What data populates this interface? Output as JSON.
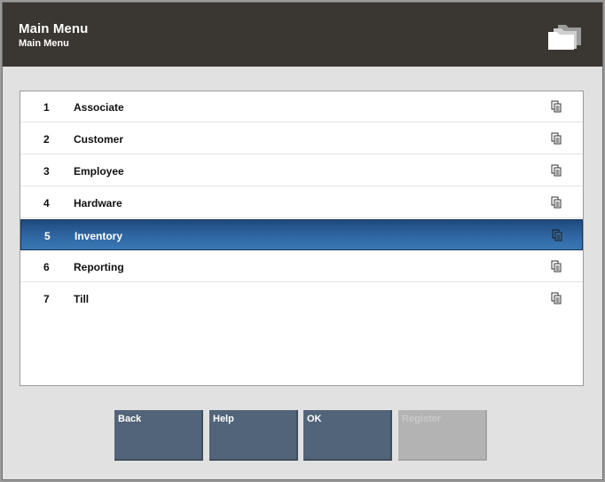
{
  "header": {
    "title": "Main Menu",
    "subtitle": "Main Menu",
    "icon": "folders-icon"
  },
  "menu": {
    "selected_index": 4,
    "items": [
      {
        "number": "1",
        "label": "Associate"
      },
      {
        "number": "2",
        "label": "Customer"
      },
      {
        "number": "3",
        "label": "Employee"
      },
      {
        "number": "4",
        "label": "Hardware"
      },
      {
        "number": "5",
        "label": "Inventory"
      },
      {
        "number": "6",
        "label": "Reporting"
      },
      {
        "number": "7",
        "label": "Till"
      }
    ],
    "item_icon": "document-copy-icon"
  },
  "buttons": {
    "back": "Back",
    "help": "Help",
    "ok": "OK",
    "register": "Register"
  },
  "colors": {
    "header_bg": "#3a3631",
    "selected_row": "#2f67a3",
    "button_bg": "#526479",
    "button_disabled": "#b3b3b3"
  }
}
